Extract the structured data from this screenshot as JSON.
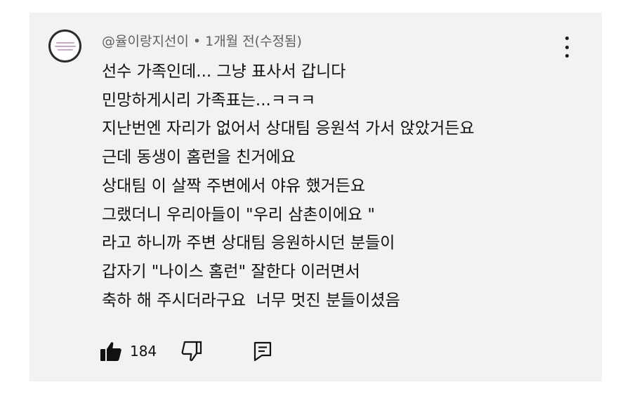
{
  "comment": {
    "author": "@율이랑지선이",
    "separator": "•",
    "time": "1개월 전(수정됨)",
    "lines": [
      "선수 가족인데... 그냥 표사서 갑니다",
      "민망하게시리 가족표는...ㅋㅋㅋ",
      "지난번엔 자리가 없어서 상대팀 응원석 가서 앉았거든요",
      "근데 동생이 홈런을 친거에요",
      "상대팀 이 살짝 주변에서 야유 했거든요",
      "그랬더니 우리아들이 \"우리 삼촌이에요 \"",
      "라고 하니까 주변 상대팀 응원하시던 분들이",
      "갑자기 \"나이스 홈런\" 잘한다 이러면서",
      "축하 해 주시더라구요  너무 멋진 분들이셨음"
    ],
    "like_count": "184"
  },
  "icons": {
    "avatar": "avatar-image",
    "menu": "more-vertical-icon",
    "like": "thumbs-up-filled-icon",
    "dislike": "thumbs-down-outline-icon",
    "reply": "reply-comment-icon"
  },
  "colors": {
    "card_background": "#f2f2f2",
    "text": "#111111",
    "meta_text": "#606060"
  }
}
